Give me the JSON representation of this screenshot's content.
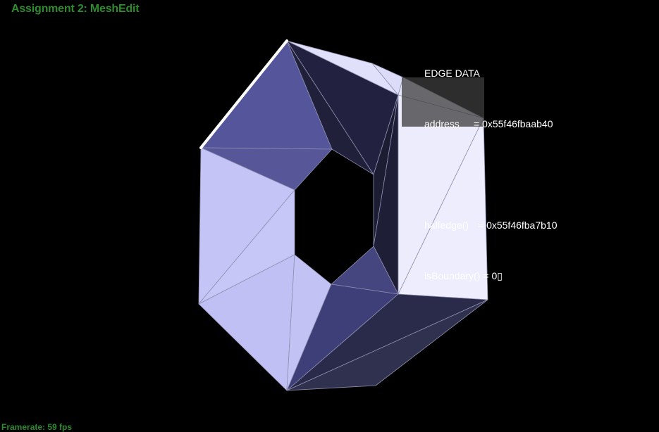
{
  "app": {
    "title": "Assignment 2: MeshEdit",
    "title_color": "#2e8b2e"
  },
  "status": {
    "framerate": "Framerate: 59 fps",
    "color": "#2e8b2e"
  },
  "edge_panel": {
    "heading": "EDGE DATA",
    "address_label": "address",
    "address_value": "= 0x55f46fbaab40",
    "halfedge_label": "halfedge()",
    "halfedge_value": "= 0x55f46fba7b10",
    "boundary_label": "isBoundary()",
    "boundary_value": "= 0▯"
  },
  "mesh": {
    "selected_edge_color": "#ffffff",
    "wireframe_color": "#9a9ab8"
  }
}
